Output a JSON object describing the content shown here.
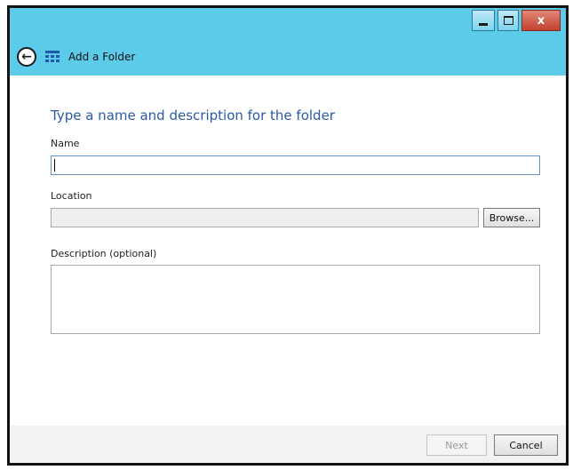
{
  "window": {
    "title": "Add a Folder",
    "caption_min": "",
    "caption_max": "",
    "caption_close": "x"
  },
  "colors": {
    "titlebar": "#5ccbea",
    "heading": "#2a5aa6",
    "close": "#c2412f"
  },
  "icons": {
    "back": "back-arrow-icon",
    "app": "folder-grid-icon"
  },
  "form": {
    "heading": "Type a name and description for the folder",
    "name_label": "Name",
    "name_value": "",
    "location_label": "Location",
    "location_value": "",
    "browse_label": "Browse...",
    "description_label": "Description (optional)",
    "description_value": ""
  },
  "footer": {
    "next_label": "Next",
    "cancel_label": "Cancel"
  }
}
